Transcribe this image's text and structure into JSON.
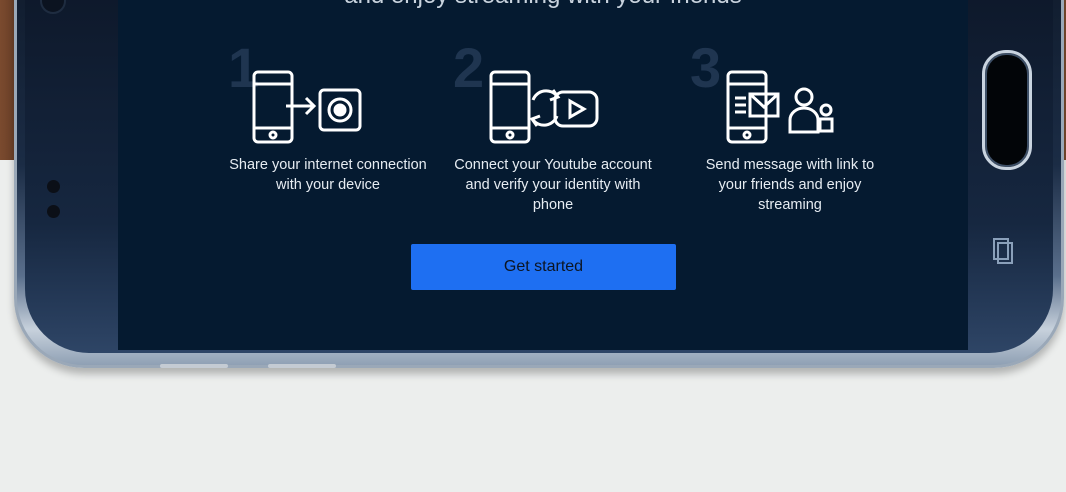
{
  "headline": "and enjoy streaming with your friends",
  "steps": [
    {
      "number": "1",
      "icon": "phone-share-icon",
      "text": "Share your internet connection with your device"
    },
    {
      "number": "2",
      "icon": "phone-sync-youtube-icon",
      "text": "Connect your Youtube account and verify your identity with phone"
    },
    {
      "number": "3",
      "icon": "phone-message-friends-icon",
      "text": "Send message with link to your friends and enjoy streaming"
    }
  ],
  "cta": {
    "label": "Get started"
  },
  "colors": {
    "screen_bg": "#051a30",
    "button": "#1e6ff2",
    "page_bg": "#eceeed"
  }
}
